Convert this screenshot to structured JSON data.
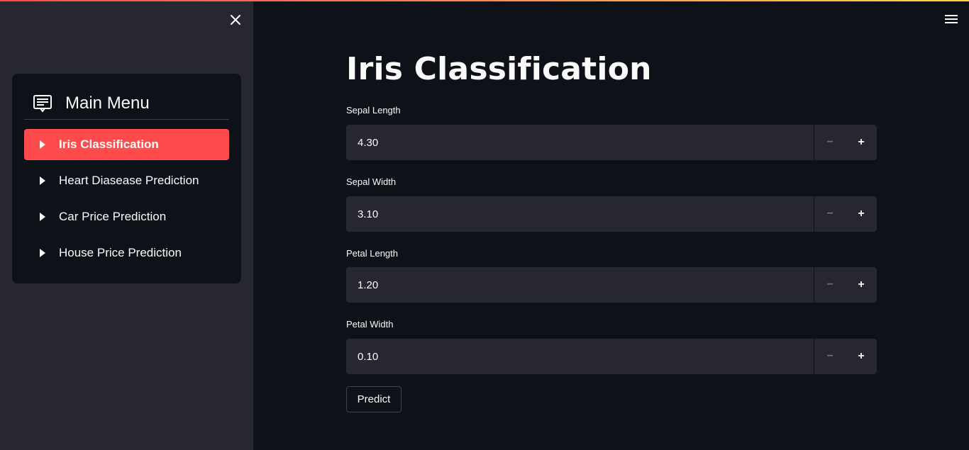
{
  "sidebar": {
    "menu_title": "Main Menu",
    "items": [
      {
        "label": "Iris Classification",
        "active": true
      },
      {
        "label": "Heart Diasease Prediction",
        "active": false
      },
      {
        "label": "Car Price Prediction",
        "active": false
      },
      {
        "label": "House Price Prediction",
        "active": false
      }
    ],
    "active_color": "#ff4b4b"
  },
  "main": {
    "title": "Iris Classification",
    "fields": [
      {
        "label": "Sepal Length",
        "value": "4.30"
      },
      {
        "label": "Sepal Width",
        "value": "3.10"
      },
      {
        "label": "Petal Length",
        "value": "1.20"
      },
      {
        "label": "Petal Width",
        "value": "0.10"
      }
    ],
    "stepper": {
      "minus": "−",
      "plus": "+"
    },
    "predict_label": "Predict"
  },
  "icons": {
    "close": "close-icon",
    "menu": "hamburger-menu-icon",
    "menu_header": "list-card-icon",
    "item": "caret-right-icon"
  },
  "colors": {
    "background": "#0e1117",
    "sidebar": "#262730",
    "accent": "#ff4b4b"
  }
}
